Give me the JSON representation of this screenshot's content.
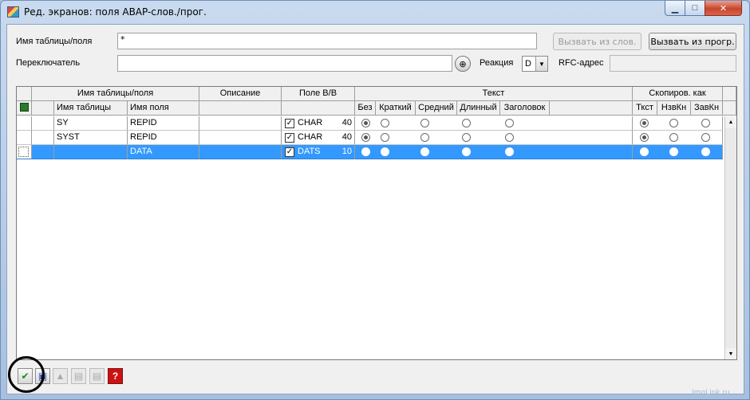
{
  "window": {
    "title": "Ред. экранов: поля ABAP-слов./прог.",
    "minimize_glyph": "▁",
    "maximize_glyph": "□",
    "close_glyph": "✕"
  },
  "form": {
    "table_field_label": "Имя таблицы/поля",
    "table_field_value": "*",
    "switch_label": "Переключатель",
    "switch_value": "",
    "call_dict_label": "Вызвать из слов.",
    "call_prog_label": "Вызвать из прогр.",
    "reaction_label": "Реакция",
    "reaction_value": "D",
    "rfc_label": "RFC-адрес",
    "rfc_value": "",
    "switch_help_icon": "⊕"
  },
  "grid": {
    "group_headers": {
      "table_field": "Имя таблицы/поля",
      "description": "Описание",
      "io_field": "Поле В/В",
      "text": "Текст",
      "copy_as": "Скопиров. как"
    },
    "columns": {
      "table_name": "Имя таблицы",
      "field_name": "Имя поля",
      "none": "Без",
      "short": "Краткий",
      "medium": "Средний",
      "long": "Длинный",
      "heading": "Заголовок",
      "text": "Ткст",
      "name_short": "НзвКн",
      "head_short": "ЗавКн"
    },
    "rows": [
      {
        "table": "SY",
        "field": "REPID",
        "desc": "",
        "checked": "✓",
        "type": "CHAR",
        "len": "40",
        "text_sel": 0,
        "copy_sel": 0,
        "selected": false
      },
      {
        "table": "SYST",
        "field": "REPID",
        "desc": "",
        "checked": "✓",
        "type": "CHAR",
        "len": "40",
        "text_sel": 0,
        "copy_sel": 0,
        "selected": false
      },
      {
        "table": "",
        "field": "DATA",
        "desc": "",
        "checked": "✓",
        "type": "DATS",
        "len": "10",
        "text_sel": -1,
        "copy_sel": -1,
        "selected": true
      }
    ]
  },
  "toolbar": {
    "confirm_glyph": "✔",
    "save_glyph": "▣",
    "up_glyph": "▲",
    "save2_glyph": "▤",
    "save3_glyph": "▤",
    "cancel_glyph": "?"
  },
  "watermark": "ImgLink.ru",
  "colors": {
    "selection": "#3399ff",
    "confirm_green": "#1a8a1a",
    "cancel_red": "#cc1111"
  }
}
